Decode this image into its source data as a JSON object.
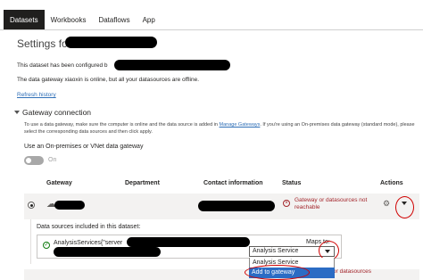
{
  "tabs": [
    {
      "label": "Datasets",
      "active": true
    },
    {
      "label": "Workbooks",
      "active": false
    },
    {
      "label": "Dataflows",
      "active": false
    },
    {
      "label": "App",
      "active": false
    }
  ],
  "page_title": "Settings for",
  "configured_text": "This dataset has been configured b",
  "gateway_status_text": "The data gateway xiaoxin is online, but all your datasources are offline.",
  "refresh_history_link": "Refresh history",
  "gateway_section": {
    "title": "Gateway connection",
    "description_before_link": "To use a data gateway, make sure the computer is online and the data source is added in ",
    "manage_gateways_link": "Manage Gateways",
    "description_after_link": ". If you're using an On-premises data gateway (standard mode), please select the corresponding data sources and then click apply.",
    "toggle_label": "Use an On-premises or VNet data gateway",
    "toggle_state": "On"
  },
  "table": {
    "headers": {
      "gateway": "Gateway",
      "department": "Department",
      "contact": "Contact information",
      "status": "Status",
      "actions": "Actions"
    },
    "row": {
      "status": "Gateway or datasources not reachable"
    },
    "row2_status": "or datasources"
  },
  "datasources_panel": {
    "heading": "Data sources included in this dataset:",
    "source_name": "AnalysisServices{\"server",
    "maps_to_label": "Maps to:",
    "selected_value": "Analysis Service",
    "options": [
      "Analysis Service",
      "Add to gateway"
    ]
  },
  "colors": {
    "accent_link": "#2f6fb7",
    "error": "#a4262c",
    "highlight": "#2b6cc4",
    "annotation": "#d00000"
  }
}
